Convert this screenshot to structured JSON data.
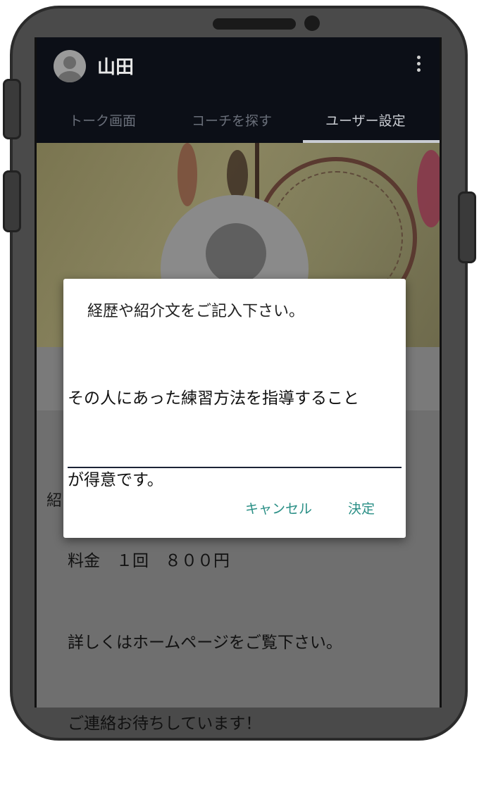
{
  "header": {
    "username": "山田",
    "menu_icon": "more-vert-icon"
  },
  "tabs": [
    {
      "label": "トーク画面",
      "active": false
    },
    {
      "label": "コーチを探す",
      "active": false
    },
    {
      "label": "ユーザー設定",
      "active": true
    }
  ],
  "profile": {
    "section_label": "紹"
  },
  "dialog": {
    "title": "経歴や紹介文をご記入下さい。",
    "lines": [
      "その人にあった練習方法を指導すること",
      "が得意です。",
      "料金　１回　８００円",
      "詳しくはホームページをご覧下さい。",
      "ご連絡お待ちしています！"
    ],
    "cancel_label": "キャンセル",
    "ok_label": "決定"
  },
  "colors": {
    "appbar": "#0c0f17",
    "accent": "#2a8f86",
    "tab_active": "#c9ccd2"
  }
}
